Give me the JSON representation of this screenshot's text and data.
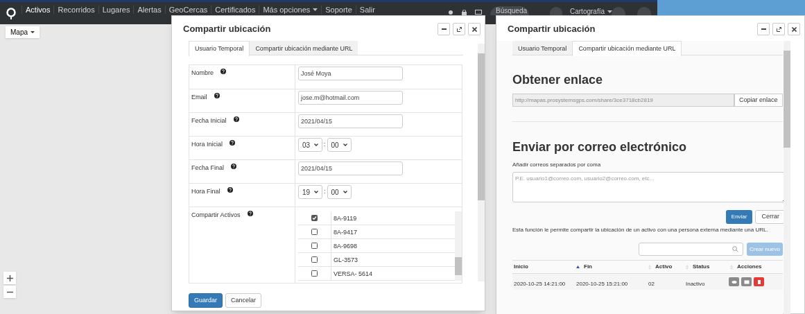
{
  "top_nav": {
    "items": [
      {
        "label": "Activos",
        "selected": true,
        "kind": "link"
      },
      {
        "label": "Recorridos",
        "selected": false,
        "kind": "link"
      },
      {
        "label": "Lugares",
        "selected": false,
        "kind": "link"
      },
      {
        "label": "Alertas",
        "selected": false,
        "kind": "link"
      },
      {
        "label": "GeoCercas",
        "selected": false,
        "kind": "link"
      },
      {
        "label": "Certificados",
        "selected": false,
        "kind": "link"
      },
      {
        "label": "Más opciones",
        "selected": false,
        "kind": "dropdown"
      },
      {
        "label": "Soporte",
        "selected": false,
        "kind": "link"
      },
      {
        "label": "Salir",
        "selected": false,
        "kind": "link"
      }
    ],
    "search": {
      "placeholder": "Búsqueda"
    },
    "cartography": "Cartografía"
  },
  "map": {
    "type_button": "Mapa"
  },
  "share_dialog": {
    "title": "Compartir ubicación",
    "tabs": [
      {
        "label": "Usuario Temporal",
        "selected": true
      },
      {
        "label": "Compartir ubicación mediante URL",
        "selected": false
      }
    ],
    "form": [
      {
        "kind": "text",
        "label": "Nombre",
        "value": "José Moya"
      },
      {
        "kind": "text",
        "label": "Email",
        "value": "jose.m@hotmail.com"
      },
      {
        "kind": "text",
        "label": "Fecha Inicial",
        "value": "2021/04/15"
      },
      {
        "kind": "time",
        "label": "Hora Inicial",
        "hour": "03",
        "separator": ":",
        "minute": "00"
      },
      {
        "kind": "text",
        "label": "Fecha Final",
        "value": "2021/04/15"
      },
      {
        "kind": "time",
        "label": "Hora Final",
        "hour": "19",
        "separator": ":",
        "minute": "00"
      },
      {
        "kind": "assets",
        "label": "Compartir Activos",
        "assets": [
          {
            "name": "8A-9119",
            "checked": true
          },
          {
            "name": "8A-9417",
            "checked": false
          },
          {
            "name": "8A-9698",
            "checked": false
          },
          {
            "name": "GL-3573",
            "checked": false
          },
          {
            "name": "VERSA- 5614",
            "checked": false
          }
        ]
      }
    ],
    "buttons": [
      {
        "label": "Guardar",
        "kind": "primary"
      },
      {
        "label": "Cancelar",
        "kind": "default"
      }
    ]
  },
  "url_dialog": {
    "title": "Compartir ubicación",
    "tabs": [
      {
        "label": "Usuario Temporal",
        "selected": false
      },
      {
        "label": "Compartir ubicación mediante URL",
        "selected": true
      }
    ],
    "link_heading": "Obtener enlace",
    "link_value": "http://mapas.prosystemsgps.com/share/3ce3718cb2819",
    "copy_button": "Copiar enlace",
    "email_heading": "Enviar por correo electrónico",
    "email_label": "Añadir correos separados por coma",
    "email_placeholder": "P.E. usuario1@correo.com, usuario2@correo.com, etc...",
    "send_button": "Enviar",
    "close_button": "Cerrar",
    "description": "Esta función le permite compartir la ubicación de un activo con una persona externa mediante una URL.",
    "create_button": "Crear nuevo",
    "table": {
      "columns": [
        {
          "label": "Inicio",
          "kind": "plain"
        },
        {
          "label": "Fin",
          "kind": "ascending"
        },
        {
          "label": "Activo",
          "kind": "sortable"
        },
        {
          "label": "Status",
          "kind": "sortable"
        },
        {
          "label": "Acciones",
          "kind": "sortable"
        }
      ],
      "rows": [
        {
          "cells": [
            "2020-10-25 14:21:00",
            "2020-10-25 15:21:00",
            "02",
            "Inactivo"
          ],
          "actions": [
            {
              "kind": "view"
            },
            {
              "kind": "email"
            },
            {
              "kind": "delete"
            }
          ]
        }
      ]
    }
  }
}
